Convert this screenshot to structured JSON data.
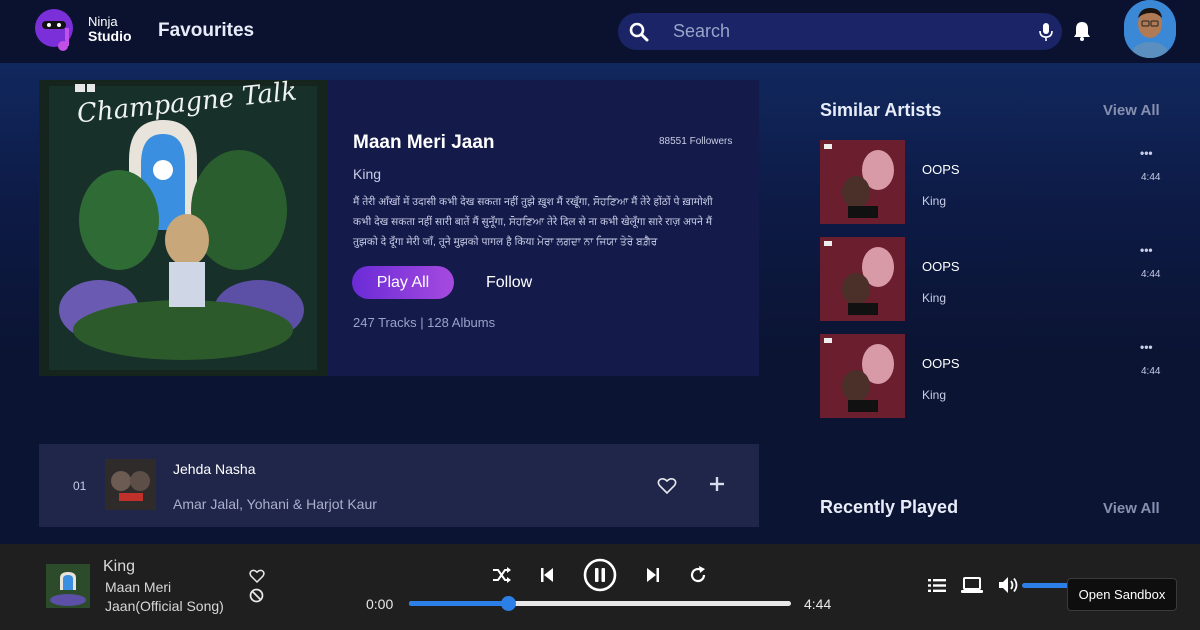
{
  "app": {
    "brand_line1": "Ninja",
    "brand_line2": "Studio",
    "page_title": "Favourites"
  },
  "search": {
    "placeholder": "Search"
  },
  "hero": {
    "album_text": "Champagne Talk",
    "artist_title": "Maan Meri Jaan",
    "followers": "88551 Followers",
    "artist_sub": "King",
    "lyrics": "मैं तेरी आँखों में उदासी कभी देख सकता नहीं तुझे ख़ुश मैं रखूँगा, ਸੋਹਣਿਆ मैं तेरे होंठों पे ख़ामोशी कभी देख सकता नहीं सारी बातें मैं सुनूँगा, ਸੋਹਣਿਆ तेरे दिल से ना कभी खेलूँगा सारे राज़ अपने मैं तुझको दे दूँगा मेरी जाँ, तूने मुझको पागल है किया ਮੇਰਾ ਲਗਦਾ ਨਾ ਜਿਯਾ ਤੇਰੇ ਬਗ਼ੈਰ",
    "play_all": "Play All",
    "follow": "Follow",
    "counts": "247 Tracks | 128 Albums"
  },
  "tracks": [
    {
      "no": "01",
      "title": "Jehda Nasha",
      "artist": "Amar Jalal, Yohani & Harjot Kaur"
    }
  ],
  "similar": {
    "heading": "Similar Artists",
    "view_all": "View All",
    "items": [
      {
        "title": "OOPS",
        "artist": "King",
        "duration": "4:44",
        "more": "•••"
      },
      {
        "title": "OOPS",
        "artist": "King",
        "duration": "4:44",
        "more": "•••"
      },
      {
        "title": "OOPS",
        "artist": "King",
        "duration": "4:44",
        "more": "•••"
      }
    ]
  },
  "recent": {
    "heading": "Recently Played",
    "view_all": "View All"
  },
  "player": {
    "artist": "King",
    "song": "Maan Meri Jaan(Official Song)",
    "time_current": "0:00",
    "time_total": "4:44",
    "progress": 0.26,
    "sandbox": "Open Sandbox"
  },
  "colors": {
    "background": "#0b1433",
    "accent_blue": "#2d7fe8",
    "play_gradient_start": "#6a2bd6",
    "play_gradient_end": "#a64adf"
  },
  "icons": {
    "search": "search-icon",
    "mic": "mic-icon",
    "bell": "bell-icon",
    "heart": "heart-icon",
    "plus": "plus-icon",
    "shuffle": "shuffle-icon",
    "prev": "skip-back-icon",
    "pause": "pause-icon",
    "next": "skip-forward-icon",
    "repeat": "repeat-icon",
    "queue": "queue-list-icon",
    "device": "laptop-icon",
    "volume": "volume-icon"
  }
}
